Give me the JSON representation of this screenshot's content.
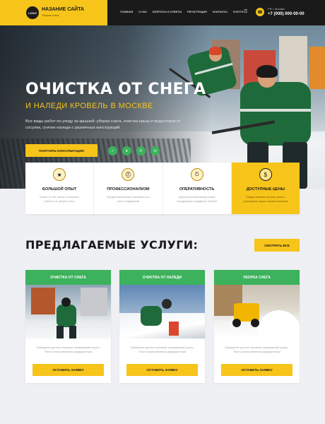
{
  "header": {
    "logo": "LOGO",
    "site_name": "НАЗАНИЕ САЙТА",
    "site_sub": "Уборка снега",
    "nav": [
      "ГЛАВНАЯ",
      "О НАС",
      "ВОПРОСЫ И ОТВЕТЫ",
      "РЕГИСТРАЦИЯ",
      "КОНТАКТЫ",
      "УСЛУГИ"
    ],
    "city": "РФ г. Москва",
    "phone": "+7 (000) 000-00-00",
    "menu_icon": "☰",
    "phone_icon": "☎"
  },
  "hero": {
    "title": "ОЧИСТКА ОТ СНЕГА",
    "subtitle": "И НАЛЕДИ КРОВЕЛЬ В МОСКВЕ",
    "description": "Все виды работ по уходу за крышей: уборка снега, очистка крыш и водостоков от сосулек, снятие наледи с различных конструкций.",
    "cta_label": "ПОЛУЧИТЬ КОНСУЛЬТАЦИЮ",
    "socials": [
      "vk-icon",
      "telegram-icon",
      "whatsapp-icon",
      "viber-icon"
    ],
    "social_glyphs": [
      "✓",
      "➤",
      "✆",
      "☏"
    ]
  },
  "features": [
    {
      "title": "БОЛЬШОЙ ОПЫТ",
      "text": "Более 10 лет опыта в сезонных работах по уборке снега",
      "icon": "award-icon",
      "glyph": "★"
    },
    {
      "title": "ПРОФЕССИОНАЛИЗМ",
      "text": "Профессиональные альпинисты и штат сотрудников",
      "icon": "helmet-icon",
      "glyph": "⛑"
    },
    {
      "title": "ОПЕРАТИВНОСТЬ",
      "text": "Круглосуточный выезд наших сотрудников в пределах области",
      "icon": "stopwatch-icon",
      "glyph": "⏱"
    },
    {
      "title": "ДОСТУПНЫЕ ЦЕНЫ",
      "text": "Предоставляем лучшие цены и регулярные акции нашим клиентам",
      "icon": "coins-icon",
      "glyph": "$"
    }
  ],
  "services": {
    "title": "ПРЕДЛАГАЕМЫЕ УСЛУГИ:",
    "see_all": "СМОТРЕТЬ ВСЕ",
    "cards": [
      {
        "title": "ОЧИСТКА ОТ СНЕГА",
        "text": "Примерное краткое описание оказываемой услуги. Текст сильно является редакционным",
        "button": "ОСТАВИТЬ ЗАЯВКУ"
      },
      {
        "title": "ОЧИСТКА ОТ НАЛЕДИ",
        "text": "Примерное краткое описание оказываемой услуги. Текст сильно является редакционным",
        "button": "ОСТАВИТЬ ЗАЯВКУ"
      },
      {
        "title": "УБОРКА СНЕГА",
        "text": "Примерное краткое описание оказываемой услуги. Текст сильно является редакционным",
        "button": "ОСТАВИТЬ ЗАЯВКУ"
      }
    ]
  },
  "colors": {
    "accent": "#f7c41a",
    "green": "#3cb25c",
    "dark": "#1a1a1a"
  }
}
